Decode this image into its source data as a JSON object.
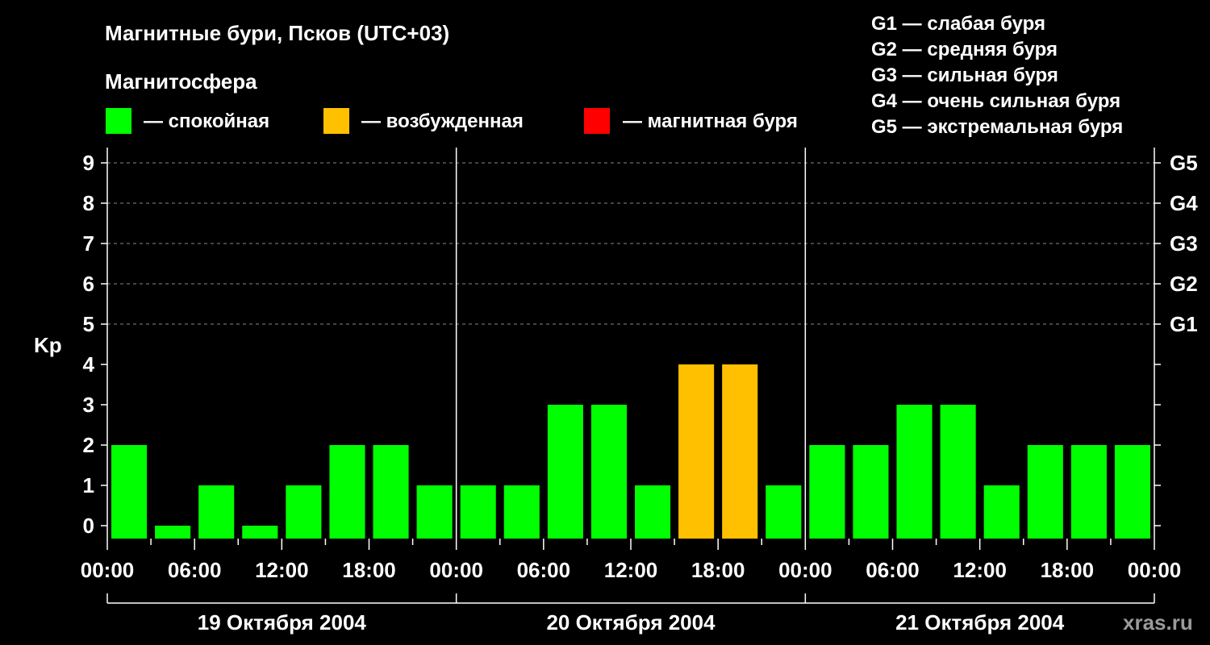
{
  "chart_data": {
    "type": "bar",
    "title": "Магнитные бури, Псков (UTC+03)",
    "subtitle": "Магнитосфера",
    "ylabel": "Kp",
    "ylim": [
      0,
      9
    ],
    "yticks": [
      "0",
      "1",
      "2",
      "3",
      "4",
      "5",
      "6",
      "7",
      "8",
      "9"
    ],
    "right_ticks": [
      "G1",
      "G2",
      "G3",
      "G4",
      "G5"
    ],
    "legend_states": [
      {
        "label": "— спокойная",
        "color": "#00ff00"
      },
      {
        "label": "— возбужденная",
        "color": "#ffc000"
      },
      {
        "label": "— магнитная буря",
        "color": "#ff0000"
      }
    ],
    "storm_scale": [
      "G1 — слабая буря",
      "G2 — средняя буря",
      "G3 — сильная буря",
      "G4 — очень сильная буря",
      "G5 — экстремальная буря"
    ],
    "xticks": [
      "00:00",
      "06:00",
      "12:00",
      "18:00",
      "00:00",
      "06:00",
      "12:00",
      "18:00",
      "00:00",
      "06:00",
      "12:00",
      "18:00",
      "00:00"
    ],
    "days": [
      "19 Октября 2004",
      "20 Октября 2004",
      "21 Октября 2004"
    ],
    "values": [
      2,
      0,
      1,
      0,
      1,
      2,
      2,
      1,
      1,
      1,
      3,
      3,
      1,
      4,
      4,
      1,
      2,
      2,
      3,
      3,
      1,
      2,
      2,
      2
    ],
    "colors": {
      "quiet": "#00ff00",
      "active": "#ffc000",
      "storm": "#ff0000",
      "grid": "#888888",
      "axis": "#ffffff"
    }
  },
  "watermark": "xras.ru"
}
